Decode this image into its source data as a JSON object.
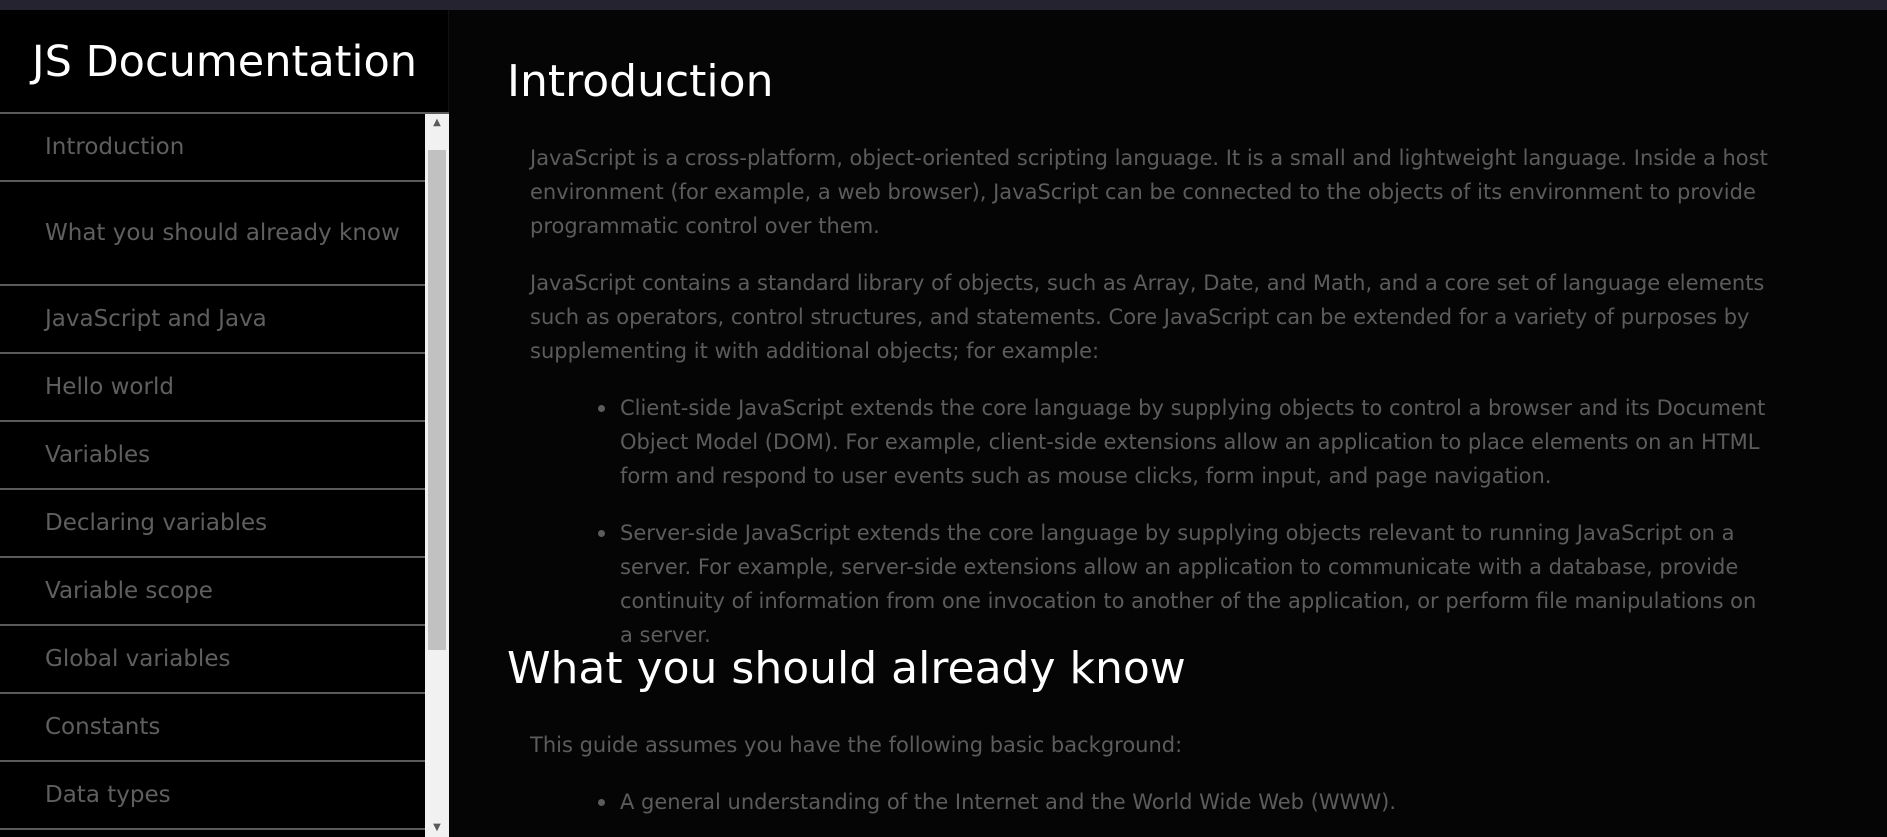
{
  "sidebar": {
    "title": "JS Documentation",
    "items": [
      {
        "label": "Introduction"
      },
      {
        "label": "What you should already know"
      },
      {
        "label": "JavaScript and Java"
      },
      {
        "label": "Hello world"
      },
      {
        "label": "Variables"
      },
      {
        "label": "Declaring variables"
      },
      {
        "label": "Variable scope"
      },
      {
        "label": "Global variables"
      },
      {
        "label": "Constants"
      },
      {
        "label": "Data types"
      }
    ]
  },
  "main": {
    "intro": {
      "title": "Introduction",
      "paragraphs": [
        "JavaScript is a cross-platform, object-oriented scripting language. It is a small and lightweight language. Inside a host environment (for example, a web browser), JavaScript can be connected to the objects of its environment to provide programmatic control over them.",
        "JavaScript contains a standard library of objects, such as Array, Date, and Math, and a core set of language elements such as operators, control structures, and statements. Core JavaScript can be extended for a variety of purposes by supplementing it with additional objects; for example:"
      ],
      "bullets": [
        "Client-side JavaScript extends the core language by supplying objects to control a browser and its Document Object Model (DOM). For example, client-side extensions allow an application to place elements on an HTML form and respond to user events such as mouse clicks, form input, and page navigation.",
        "Server-side JavaScript extends the core language by supplying objects relevant to running JavaScript on a server. For example, server-side extensions allow an application to communicate with a database, provide continuity of information from one invocation to another of the application, or perform file manipulations on a server."
      ]
    },
    "know": {
      "title": "What you should already know",
      "paragraphs": [
        "This guide assumes you have the following basic background:"
      ],
      "bullets": [
        "A general understanding of the Internet and the World Wide Web (WWW)."
      ]
    }
  },
  "icons": {
    "scroll_up": "scroll-up-arrow-icon",
    "scroll_down": "scroll-down-arrow-icon"
  }
}
